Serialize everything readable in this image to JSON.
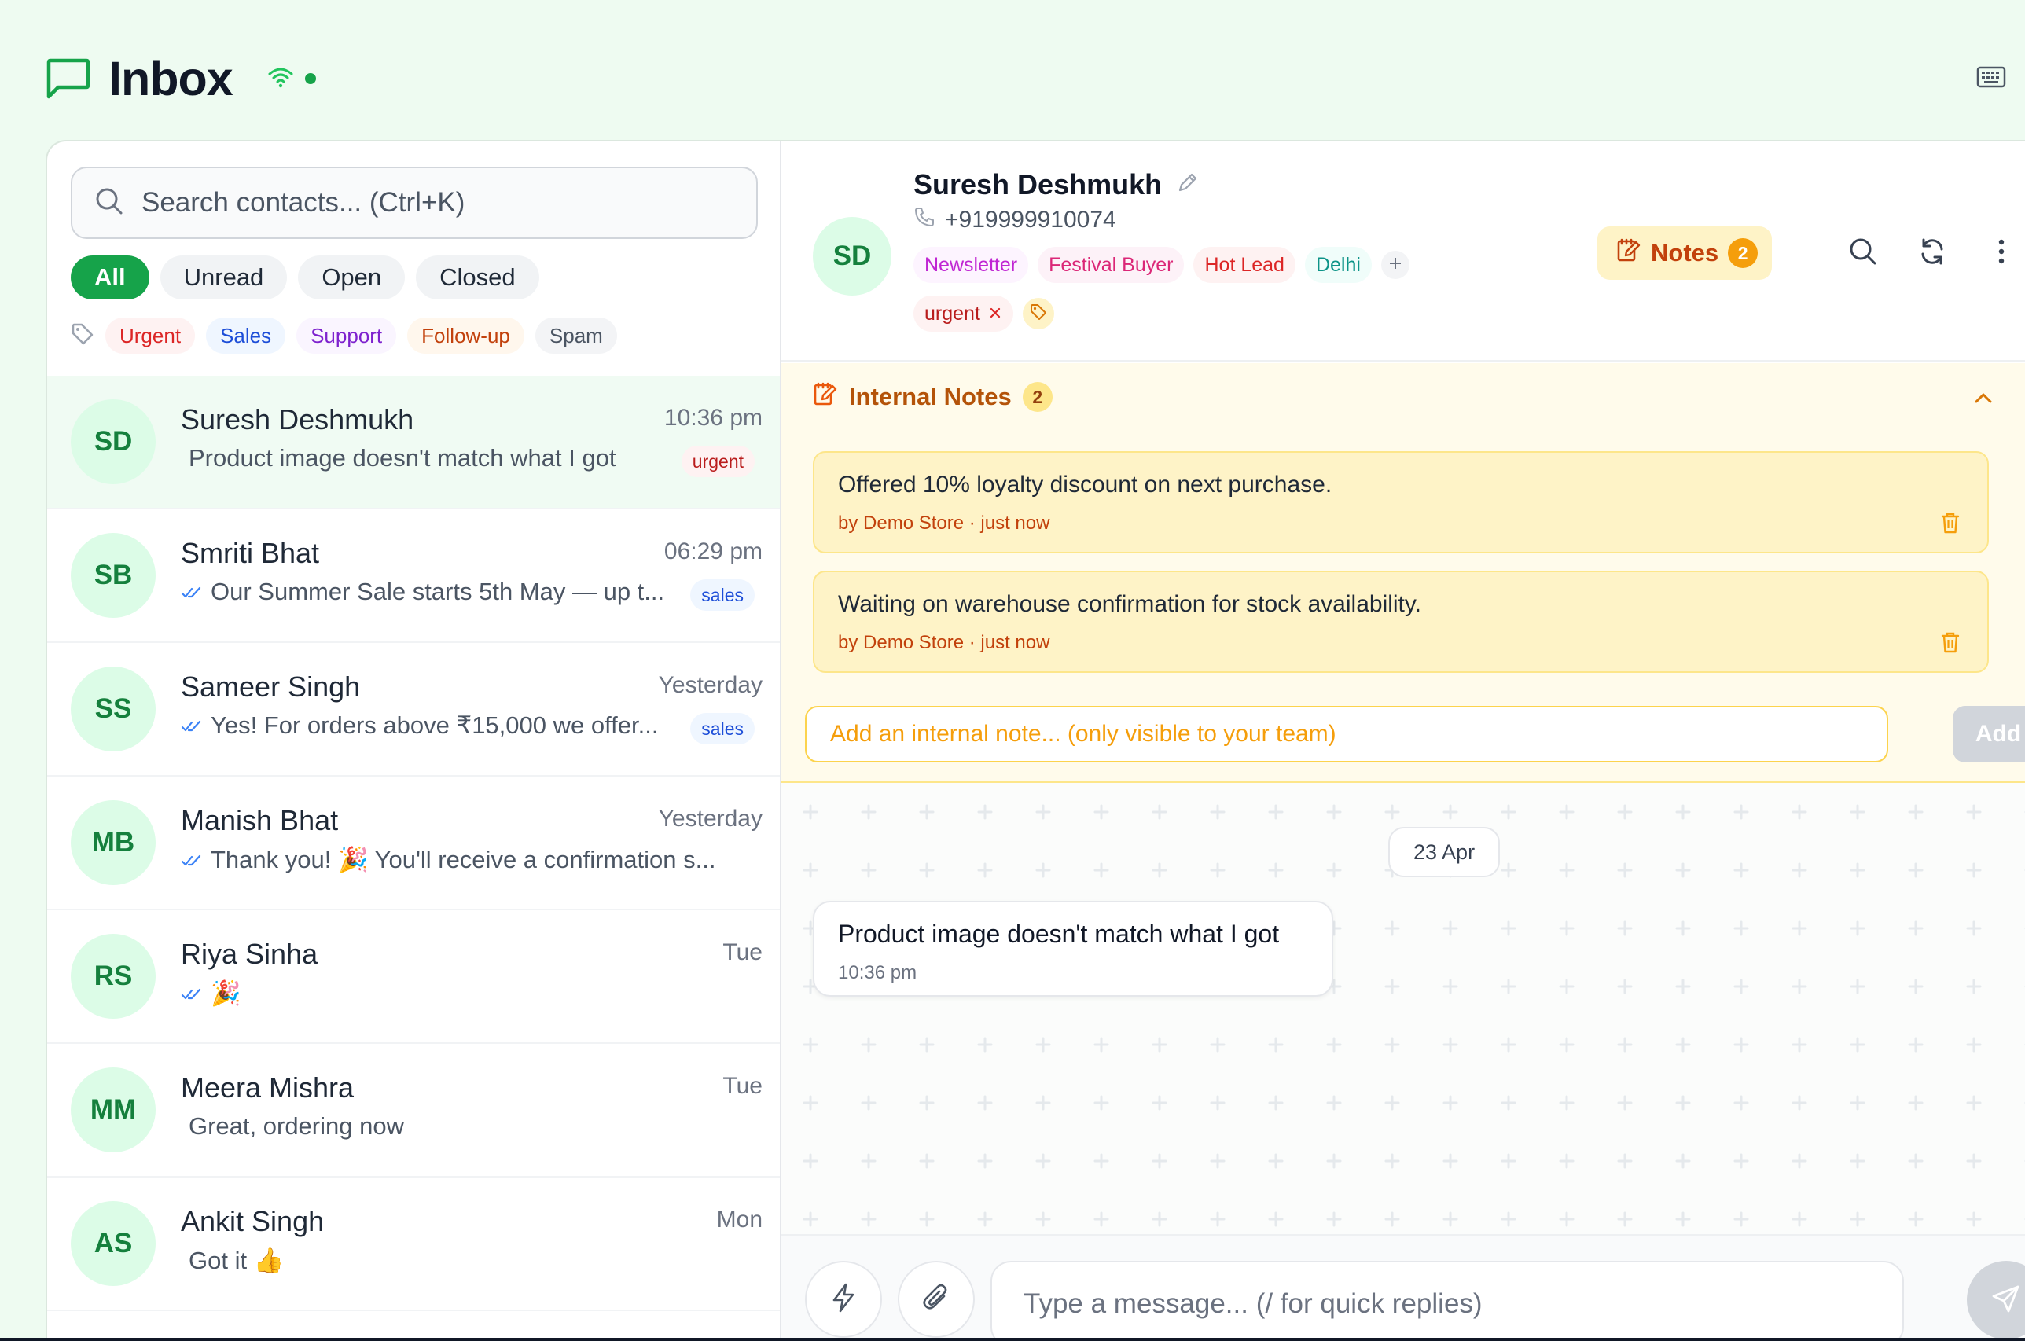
{
  "header": {
    "title": "Inbox"
  },
  "search": {
    "placeholder": "Search contacts... (Ctrl+K)"
  },
  "filters": [
    "All",
    "Unread",
    "Open",
    "Closed"
  ],
  "labels": [
    {
      "text": "Urgent",
      "color": "#dc2626",
      "bg": "#fef2f2"
    },
    {
      "text": "Sales",
      "color": "#1d4ed8",
      "bg": "#eff6ff"
    },
    {
      "text": "Support",
      "color": "#7e22ce",
      "bg": "#faf5ff"
    },
    {
      "text": "Follow-up",
      "color": "#c2410c",
      "bg": "#fff7ed"
    },
    {
      "text": "Spam",
      "color": "#4b5563",
      "bg": "#f3f4f6"
    }
  ],
  "contacts": [
    {
      "initials": "SD",
      "name": "Suresh Deshmukh",
      "time": "10:36 pm",
      "preview": "Product image doesn't match what I got",
      "read": false,
      "tag": "urgent",
      "tag_color": "#b91c1c",
      "tag_bg": "#fef2f2",
      "selected": true
    },
    {
      "initials": "SB",
      "name": "Smriti Bhat",
      "time": "06:29 pm",
      "preview": "Our Summer Sale starts 5th May — up t...",
      "read": true,
      "tag": "sales",
      "tag_color": "#1d4ed8",
      "tag_bg": "#eff6ff",
      "selected": false
    },
    {
      "initials": "SS",
      "name": "Sameer Singh",
      "time": "Yesterday",
      "preview": "Yes! For orders above ₹15,000 we offer...",
      "read": true,
      "tag": "sales",
      "tag_color": "#1d4ed8",
      "tag_bg": "#eff6ff",
      "selected": false
    },
    {
      "initials": "MB",
      "name": "Manish Bhat",
      "time": "Yesterday",
      "preview": "Thank you! 🎉 You'll receive a confirmation s...",
      "read": true,
      "tag": "",
      "selected": false
    },
    {
      "initials": "RS",
      "name": "Riya Sinha",
      "time": "Tue",
      "preview": "🎉",
      "read": true,
      "tag": "",
      "selected": false
    },
    {
      "initials": "MM",
      "name": "Meera Mishra",
      "time": "Tue",
      "preview": "Great, ordering now",
      "read": false,
      "tag": "",
      "selected": false
    },
    {
      "initials": "AS",
      "name": "Ankit Singh",
      "time": "Mon",
      "preview": "Got it 👍",
      "read": false,
      "tag": "",
      "selected": false
    }
  ],
  "contact_header": {
    "initials": "SD",
    "name": "Suresh Deshmukh",
    "phone": "+919999910074",
    "tags": [
      {
        "text": "Newsletter",
        "color": "#c026d3",
        "bg": "#fdf4ff"
      },
      {
        "text": "Festival Buyer",
        "color": "#db2777",
        "bg": "#fdf2f8"
      },
      {
        "text": "Hot Lead",
        "color": "#dc2626",
        "bg": "#fef2f2"
      },
      {
        "text": "Delhi",
        "color": "#0d9488",
        "bg": "#f0fdfa"
      }
    ],
    "label": "urgent",
    "notes_label": "Notes",
    "notes_count": "2"
  },
  "notes": {
    "title": "Internal Notes",
    "count": "2",
    "items": [
      {
        "text": "Offered 10% loyalty discount on next purchase.",
        "meta": "by Demo Store · just now"
      },
      {
        "text": "Waiting on warehouse confirmation for stock availability.",
        "meta": "by Demo Store · just now"
      }
    ],
    "input_placeholder": "Add an internal note... (only visible to your team)",
    "add_label": "Add"
  },
  "chat": {
    "date": "23 Apr",
    "messages": [
      {
        "text": "Product image doesn't match what I got",
        "time": "10:36 pm"
      }
    ],
    "input_placeholder": "Type a message... (/ for quick replies)"
  },
  "colors": {
    "brand": "#16a34a",
    "amber": "#f59e0b",
    "avatar_bg": "#dcfce7"
  }
}
